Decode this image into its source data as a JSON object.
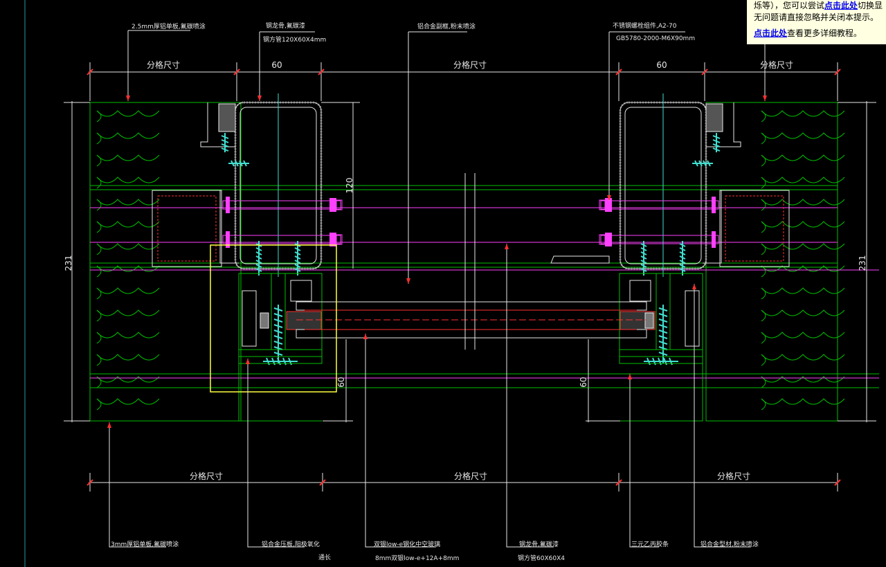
{
  "labels": {
    "top_left_panel": "2.5mm厚铝单板,氟碳喷涂",
    "top_steel_keel": "钢龙骨,氟碳漆",
    "top_steel_tube": "钢方管120X60X4mm",
    "top_alu_cover": "铝合金副框,粉末喷涂",
    "top_bolt": "不锈钢螺栓组件,A2-70",
    "top_bolt_spec": "GB5780-2000-M6X90mm",
    "bottom_panel": "3mm厚铝单板,氟碳喷涂",
    "bottom_pressplate": "铝合金压板,阳极氧化",
    "bottom_pressplate_sub": "通长",
    "bottom_glass": "双银low-e钢化中空玻璃",
    "bottom_glass_spec": "8mm双银low-e+12A+8mm",
    "bottom_steel_keel": "钢龙骨,氟碳漆",
    "bottom_steel_tube": "钢方管60X60X4",
    "bottom_epdm": "三元乙丙胶条",
    "bottom_alu_profile": "铝合金型材,粉末喷涂"
  },
  "dims": {
    "grid_size": "分格尺寸",
    "d60": "60",
    "d120": "120",
    "d231": "231"
  },
  "tooltip": {
    "line1_pre": "烁等），您可以尝试",
    "line1_link": "点击此处",
    "line1_post": "切换显",
    "line2": "无问题请直接忽略并关闭本提示。",
    "line3_link": "点击此处",
    "line3_post": "查看更多详细教程。"
  },
  "colors": {
    "background": "#000000",
    "green": "#00c000",
    "white": "#e8e8e8",
    "red": "#ff3030",
    "magenta": "#ff40ff",
    "cyan": "#40e0d0",
    "yellow": "#ffff40",
    "tooltip_bg": "#ffffe1"
  }
}
